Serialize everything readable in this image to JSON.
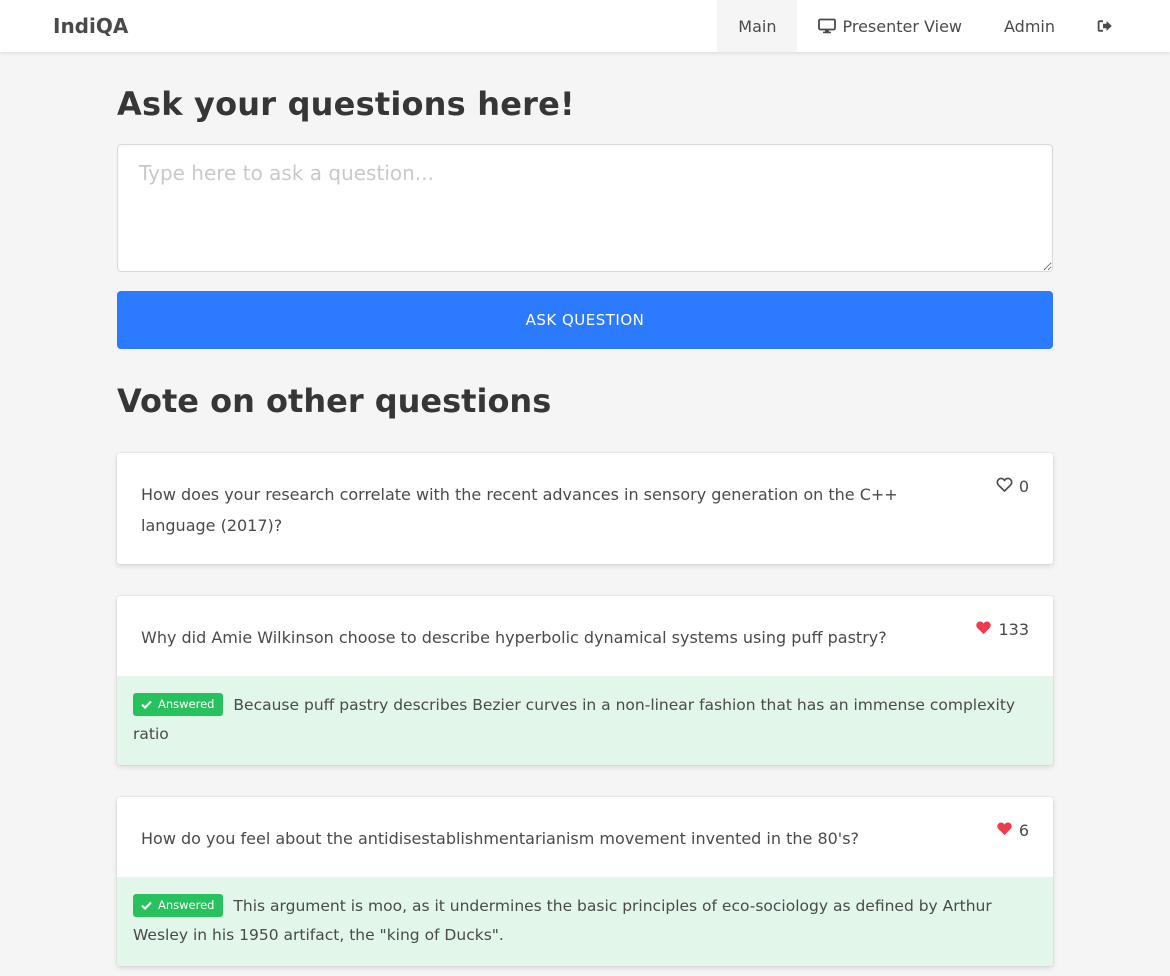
{
  "nav": {
    "brand": "IndiQA",
    "items": [
      {
        "label": "Main",
        "icon": "none",
        "active": true
      },
      {
        "label": "Presenter View",
        "icon": "desktop-icon",
        "active": false
      },
      {
        "label": "Admin",
        "icon": "none",
        "active": false
      }
    ],
    "logout_icon": "sign-out-icon"
  },
  "ask": {
    "heading": "Ask your questions here!",
    "placeholder": "Type here to ask a question...",
    "button_label": "ASK QUESTION"
  },
  "vote": {
    "heading": "Vote on other questions"
  },
  "questions": [
    {
      "text": "How does your research correlate with the recent advances in sensory generation on the C++ language (2017)?",
      "votes": "0",
      "liked": false
    },
    {
      "text": "Why did Amie Wilkinson choose to describe hyperbolic dynamical systems using puff pastry?",
      "votes": "133",
      "liked": true,
      "answer_badge": "Answered",
      "answer": "Because puff pastry describes Bezier curves in a non-linear fashion that has an immense complexity ratio"
    },
    {
      "text": "How do you feel about the antidisestablishmentarianism movement invented in the 80's?",
      "votes": "6",
      "liked": true,
      "answer_badge": "Answered",
      "answer": "This argument is moo, as it undermines the basic principles of eco-sociology as defined by Arthur Wesley in his 1950 artifact, the \"king of Ducks\"."
    }
  ],
  "colors": {
    "primary": "#2b7aff",
    "heart": "#f03a4e",
    "answered_badge": "#27c25d",
    "answer_bg": "#e2f6ea"
  }
}
